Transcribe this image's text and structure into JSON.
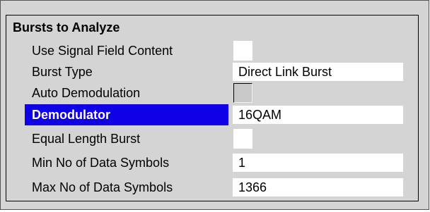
{
  "group": {
    "title": "Bursts to Analyze",
    "rows": [
      {
        "label": "Use Signal Field Content",
        "type": "checkbox",
        "checked": false
      },
      {
        "label": "Burst Type",
        "type": "field",
        "value": "Direct Link Burst"
      },
      {
        "label": "Auto Demodulation",
        "type": "checkbox",
        "checked": false,
        "disabled": true
      },
      {
        "label": "Demodulator",
        "type": "field",
        "value": "16QAM",
        "selected": true
      },
      {
        "label": "Equal Length Burst",
        "type": "checkbox",
        "checked": false
      },
      {
        "label": "Min No of Data Symbols",
        "type": "field",
        "value": "1"
      },
      {
        "label": "Max No of Data Symbols",
        "type": "field",
        "value": "1366"
      }
    ]
  },
  "colors": {
    "panel_background": "#d4d4d4",
    "selection_highlight": "#0f00e6",
    "field_background": "#ffffff"
  }
}
